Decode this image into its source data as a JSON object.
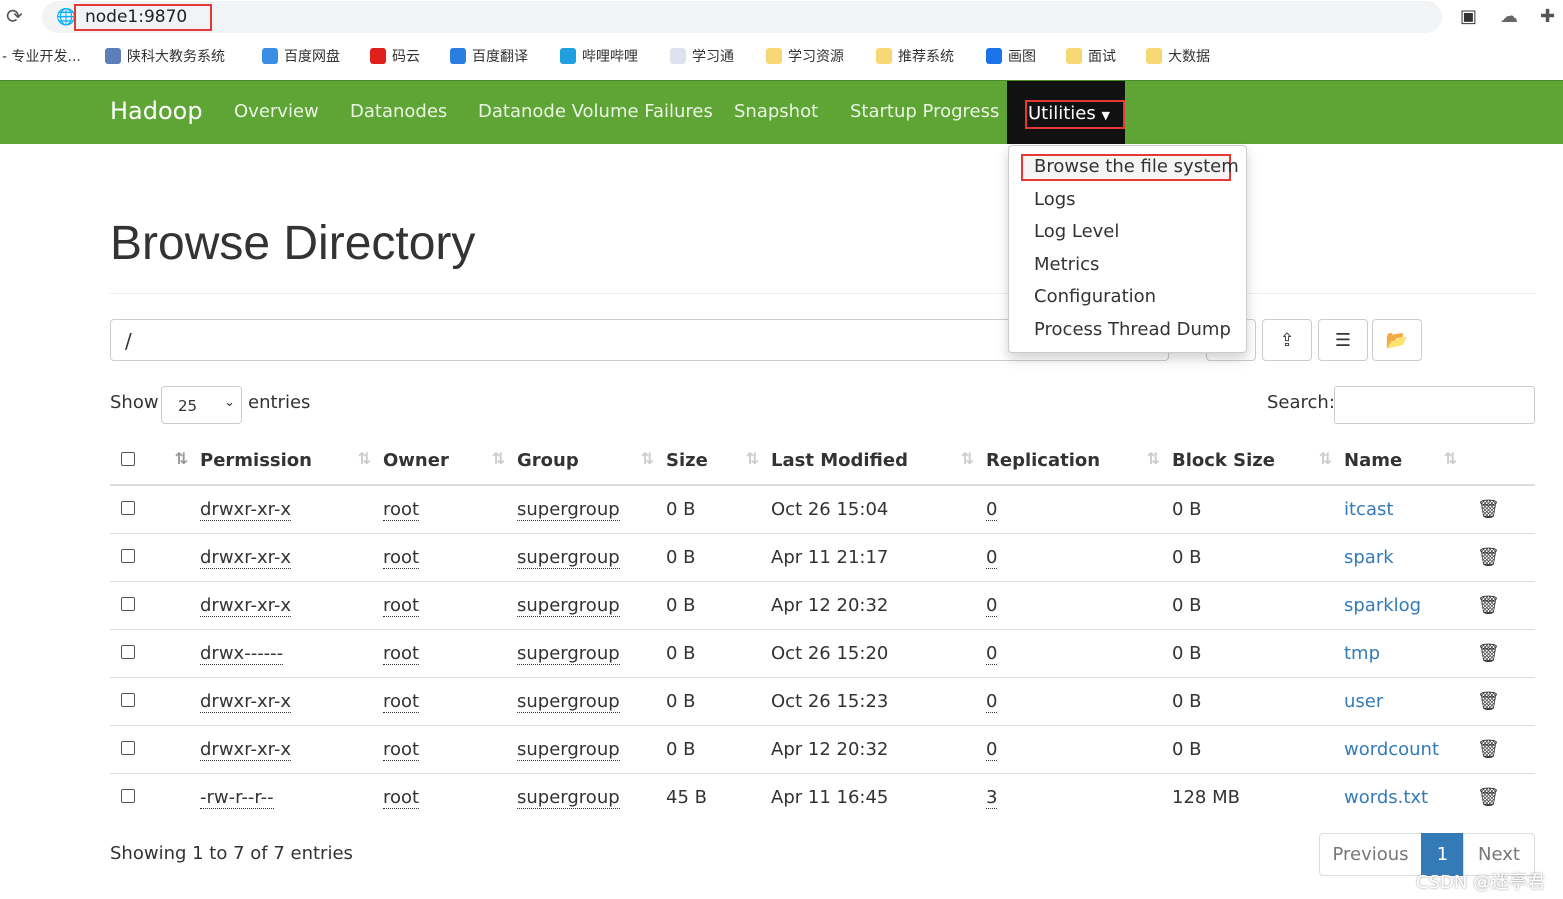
{
  "browser": {
    "url": "node1:9870",
    "bookmarks": [
      "- 专业开发...",
      "陕科大教务系统",
      "百度网盘",
      "码云",
      "百度翻译",
      "哔哩哔哩",
      "学习通",
      "学习资源",
      "推荐系统",
      "画图",
      "面试",
      "大数据"
    ]
  },
  "nav": {
    "brand": "Hadoop",
    "items": [
      "Overview",
      "Datanodes",
      "Datanode Volume Failures",
      "Snapshot",
      "Startup Progress"
    ],
    "utilities": "Utilities"
  },
  "dropdown": [
    "Browse the file system",
    "Logs",
    "Log Level",
    "Metrics",
    "Configuration",
    "Process Thread Dump"
  ],
  "page": {
    "title": "Browse Directory",
    "path": "/",
    "show": "Show",
    "entries_count": "25",
    "entries": "entries",
    "search_label": "Search:"
  },
  "table": {
    "headers": [
      "Permission",
      "Owner",
      "Group",
      "Size",
      "Last Modified",
      "Replication",
      "Block Size",
      "Name"
    ],
    "rows": [
      [
        "drwxr-xr-x",
        "root",
        "supergroup",
        "0 B",
        "Oct 26 15:04",
        "0",
        "0 B",
        "itcast"
      ],
      [
        "drwxr-xr-x",
        "root",
        "supergroup",
        "0 B",
        "Apr 11 21:17",
        "0",
        "0 B",
        "spark"
      ],
      [
        "drwxr-xr-x",
        "root",
        "supergroup",
        "0 B",
        "Apr 12 20:32",
        "0",
        "0 B",
        "sparklog"
      ],
      [
        "drwx------",
        "root",
        "supergroup",
        "0 B",
        "Oct 26 15:20",
        "0",
        "0 B",
        "tmp"
      ],
      [
        "drwxr-xr-x",
        "root",
        "supergroup",
        "0 B",
        "Oct 26 15:23",
        "0",
        "0 B",
        "user"
      ],
      [
        "drwxr-xr-x",
        "root",
        "supergroup",
        "0 B",
        "Apr 12 20:32",
        "0",
        "0 B",
        "wordcount"
      ],
      [
        "-rw-r--r--",
        "root",
        "supergroup",
        "45 B",
        "Apr 11 16:45",
        "3",
        "128 MB",
        "words.txt"
      ]
    ]
  },
  "footer": {
    "info": "Showing 1 to 7 of 7 entries",
    "previous": "Previous",
    "page": "1",
    "next": "Next",
    "watermark": "CSDN @迷亭君"
  },
  "colors": {
    "navbar": "#5ea536",
    "link": "#337ab7",
    "active_page": "#337ab7",
    "highlight": "#e53935"
  }
}
